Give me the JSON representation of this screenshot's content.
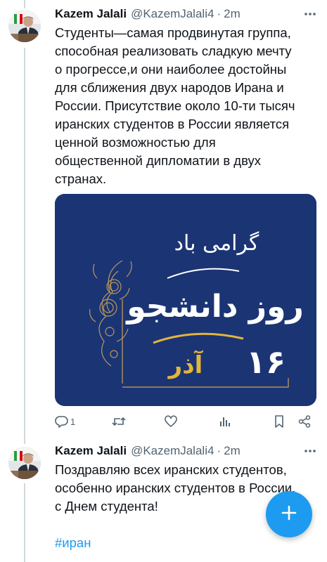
{
  "tweets": [
    {
      "author": {
        "name": "Kazem Jalali",
        "handle": "@KazemJalali4",
        "time": "2m"
      },
      "text_lines": [
        "Студенты—самая продвинутая группа,",
        "способная реализовать сладкую мечту",
        "о прогрессе,и они наиболее достойны",
        "для сближения двух народов Ирана и",
        "России. Присутствие около 10-ти тысяч",
        "иранских студентов в России является",
        "ценной возможностью для",
        "общественной дипломатии в двух",
        "странах."
      ],
      "media": {
        "image_text": {
          "line1": "روز دانشجو",
          "line2": "گرامی باد",
          "date_number": "۱۶",
          "date_month": "آذر"
        }
      },
      "actions": {
        "reply": {
          "icon": "reply-icon",
          "count": "1"
        },
        "retweet": {
          "icon": "retweet-icon"
        },
        "like": {
          "icon": "heart-icon"
        },
        "views": {
          "icon": "views-icon"
        },
        "bookmark": {
          "icon": "bookmark-icon"
        },
        "share": {
          "icon": "share-icon"
        }
      }
    },
    {
      "author": {
        "name": "Kazem Jalali",
        "handle": "@KazemJalali4",
        "time": "2m"
      },
      "text_lines": [
        "Поздравляю всех иранских студентов,",
        "особенно иранских студентов в России,",
        "с Днем студента!"
      ],
      "hashtag": "#иран"
    }
  ],
  "fab": {
    "icon": "plus-icon"
  },
  "colors": {
    "accent": "#1d9bf0",
    "text_primary": "#0f1419",
    "text_secondary": "#536471",
    "thread_line": "#cfd9de",
    "media_background": "#1b3474",
    "media_gold": "#e2b53c"
  }
}
